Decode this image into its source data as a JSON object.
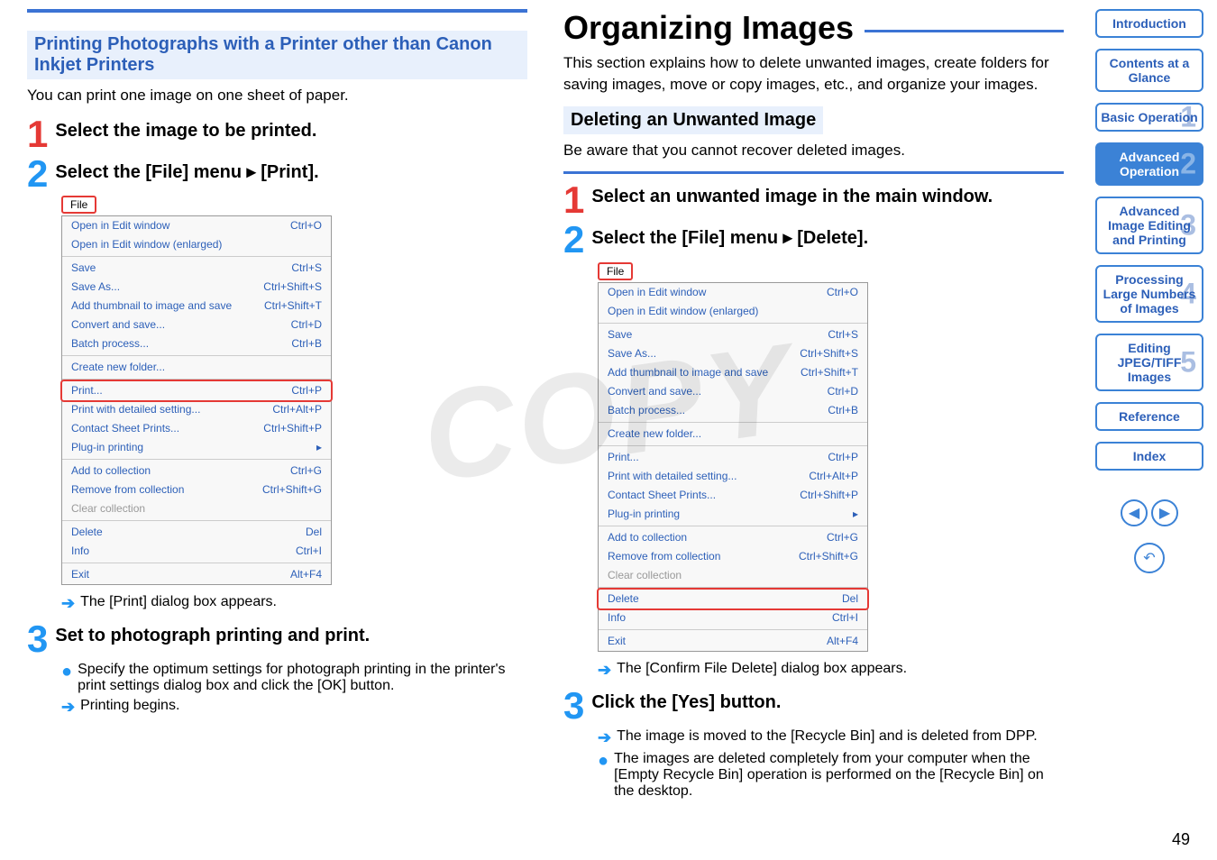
{
  "left": {
    "section_title": "Printing Photographs with a Printer other than Canon Inkjet Printers",
    "intro": "You can print one image on one sheet of paper.",
    "step1": "Select the image to be printed.",
    "step2": "Select the [File] menu ▸ [Print].",
    "file_label": "File",
    "result2": "The [Print] dialog box appears.",
    "step3": "Set to photograph printing and print.",
    "step3_body": "Specify the optimum settings for photograph printing in the printer's print settings dialog box and click the [OK] button.",
    "step3_result": "Printing begins."
  },
  "right": {
    "title": "Organizing Images",
    "intro": "This section explains how to delete unwanted images, create folders for saving images, move or copy images, etc., and organize your images.",
    "section_title": "Deleting an Unwanted Image",
    "warn": "Be aware that you cannot recover deleted images.",
    "step1": "Select an unwanted image in the main window.",
    "step2": "Select the [File] menu ▸ [Delete].",
    "file_label": "File",
    "result2": "The [Confirm File Delete] dialog box appears.",
    "step3": "Click the [Yes] button.",
    "step3_a": "The image is moved to the [Recycle Bin] and is deleted from DPP.",
    "step3_b": "The images are deleted completely from your computer when the [Empty Recycle Bin] operation is performed on the [Recycle Bin] on the desktop."
  },
  "menu_items": [
    {
      "label": "Open in Edit window",
      "sc": "Ctrl+O"
    },
    {
      "label": "Open in Edit window (enlarged)",
      "sc": ""
    },
    {
      "sep": true
    },
    {
      "label": "Save",
      "sc": "Ctrl+S"
    },
    {
      "label": "Save As...",
      "sc": "Ctrl+Shift+S"
    },
    {
      "label": "Add thumbnail to image and save",
      "sc": "Ctrl+Shift+T"
    },
    {
      "label": "Convert and save...",
      "sc": "Ctrl+D"
    },
    {
      "label": "Batch process...",
      "sc": "Ctrl+B"
    },
    {
      "sep": true
    },
    {
      "label": "Create new folder...",
      "sc": ""
    },
    {
      "sep": true
    },
    {
      "label": "Print...",
      "sc": "Ctrl+P",
      "hl": "left"
    },
    {
      "label": "Print with detailed setting...",
      "sc": "Ctrl+Alt+P"
    },
    {
      "label": "Contact Sheet Prints...",
      "sc": "Ctrl+Shift+P"
    },
    {
      "label": "Plug-in printing",
      "sc": "▸"
    },
    {
      "sep": true
    },
    {
      "label": "Add to collection",
      "sc": "Ctrl+G"
    },
    {
      "label": "Remove from collection",
      "sc": "Ctrl+Shift+G"
    },
    {
      "label": "Clear collection",
      "sc": "",
      "disabled": true
    },
    {
      "sep": true
    },
    {
      "label": "Delete",
      "sc": "Del",
      "hl": "right"
    },
    {
      "label": "Info",
      "sc": "Ctrl+I"
    },
    {
      "sep": true
    },
    {
      "label": "Exit",
      "sc": "Alt+F4"
    }
  ],
  "sidebar": {
    "items": [
      {
        "label": "Introduction"
      },
      {
        "label": "Contents at a Glance"
      },
      {
        "label": "Basic Operation",
        "num": "1"
      },
      {
        "label": "Advanced Operation",
        "num": "2",
        "active": true
      },
      {
        "label": "Advanced Image Editing and Printing",
        "num": "3"
      },
      {
        "label": "Processing Large Numbers of Images",
        "num": "4"
      },
      {
        "label": "Editing JPEG/TIFF Images",
        "num": "5"
      },
      {
        "label": "Reference"
      },
      {
        "label": "Index"
      }
    ]
  },
  "page_number": "49",
  "watermark": "COPY"
}
